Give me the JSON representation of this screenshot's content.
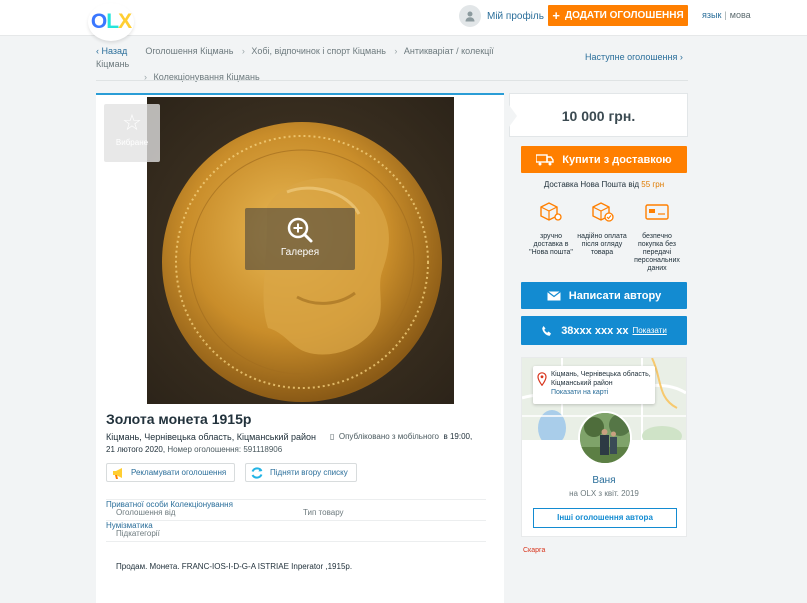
{
  "header": {
    "logo": "OLX",
    "profile_label": "Мій профіль",
    "add_button": "ДОДАТИ ОГОЛОШЕННЯ",
    "lang_label": "язык",
    "lang_current": "мова"
  },
  "breadcrumbs": {
    "back": "Назад",
    "items": [
      "Оголошення Кіцмань",
      "Хобі, відпочинок і спорт Кіцмань",
      "Антикваріат / колекції Кіцмань",
      "Колекціонування Кіцмань"
    ],
    "next": "Наступне оголошення"
  },
  "listing": {
    "favorite": "Вибране",
    "gallery": "Галерея",
    "title": "Золота монета 1915р",
    "location": "Кіцмань, Чернівецька область, Кіцманський район",
    "published_label": "Опубліковано з мобільного",
    "published_time": "в 19:00,",
    "published_date": "21 лютого 2020,",
    "ad_number_label": "Номер оголошення:",
    "ad_number": "591118906",
    "promote": "Рекламувати оголошення",
    "bump": "Підняти вгору списку",
    "details": [
      {
        "label": "Оголошення від",
        "value": "Приватної особи"
      },
      {
        "label": "Тип товару",
        "value": "Колекціонування"
      },
      {
        "label": "Підкатегорії",
        "value": "Нумізматика"
      }
    ],
    "description": "Продам. Монета. FRANC-IOS-I-D-G-A ISTRIAE Inperator ,1915р."
  },
  "sidebar": {
    "price": "10 000 грн.",
    "buy_button": "Купити з доставкою",
    "shipping_text": "Доставка Нова Пошта від",
    "shipping_amount": "55 грн",
    "features": [
      "зручно доставка в \"Нова пошта\"",
      "надійно оплата після огляду товара",
      "безпечно покупка без передачі персональних даних"
    ],
    "write_button": "Написати автору",
    "phone": "38xxx xxx xx",
    "show_phone": "Показати",
    "map_location": "Кіцмань, Чернівецька область, Кіцманський район",
    "map_link": "Показати на карті",
    "user_name": "Ваня",
    "user_since": "на OLX з квіт. 2019",
    "other_ads": "Інші оголошення автора",
    "report": "Скарга"
  },
  "colors": {
    "accent_orange": "#ff7f00",
    "accent_blue": "#138bd1",
    "link": "#2a6e9a"
  }
}
